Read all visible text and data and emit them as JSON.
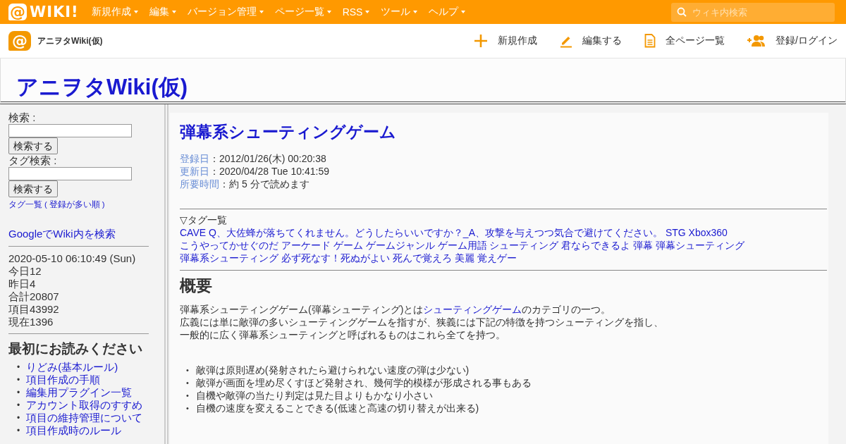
{
  "topbar": {
    "logo_symbol": "@",
    "logo_text": "WIKI!",
    "menus": [
      {
        "label": "新規作成"
      },
      {
        "label": "編集"
      },
      {
        "label": "バージョン管理"
      },
      {
        "label": "ページ一覧"
      },
      {
        "label": "RSS"
      },
      {
        "label": "ツール"
      },
      {
        "label": "ヘルプ"
      }
    ],
    "search": {
      "placeholder": "ウィキ内検索"
    }
  },
  "subbar": {
    "logo_symbol": "@",
    "site_name": "アニヲタWiki(仮)",
    "actions": [
      {
        "kind": "plus",
        "label": "新規作成"
      },
      {
        "kind": "pencil",
        "label": "編集する"
      },
      {
        "kind": "document",
        "label": "全ページ一覧"
      },
      {
        "kind": "user-add",
        "label": "登録/ログイン"
      }
    ]
  },
  "site_title": "アニヲタWiki(仮)",
  "sidebar": {
    "search_label": "検索 :",
    "search_button": "検索する",
    "tag_search_label": "タグ検索 :",
    "tag_search_button": "検索する",
    "tag_links": [
      {
        "label": "タグ一覧"
      },
      {
        "label": "登録が多い順"
      }
    ],
    "paren_open": "(",
    "paren_close": ")",
    "google_link": "GoogleでWiki内を検索",
    "counters": [
      "2020-05-10 06:10:49 (Sun)",
      "今日12",
      "昨日4",
      "合計20807",
      "項目43992",
      "現在1396"
    ],
    "read_first": {
      "heading": "最初にお読みください",
      "bullet": "•",
      "items": [
        "りどみ(基本ルール)",
        "項目作成の手順",
        "編集用プラグイン一覧",
        "アカウント取得のすすめ",
        "項目の維持管理について",
        "項目作成時のルール"
      ]
    }
  },
  "article": {
    "title": "弾幕系シューティングゲーム",
    "meta": [
      {
        "label": "登録日",
        "value": "：2012/01/26(木) 00:20:38"
      },
      {
        "label": "更新日",
        "value": "：2020/04/28 Tue 10:41:59"
      },
      {
        "label": "所要時間",
        "value": "：約 5 分で読めます"
      }
    ],
    "tags_heading": "▽タグ一覧",
    "tags": [
      "CAVE",
      "Q、大佐蜂が落ちてくれません。どうしたらいいですか？_A、攻撃を与えつつ気合で避けてください。",
      "STG",
      "Xbox360",
      "こうやってかせぐのだ",
      "アーケード",
      "ゲーム",
      "ゲームジャンル",
      "ゲーム用語",
      "シューティング",
      "君ならできるよ",
      "弾幕",
      "弾幕シューティング",
      "弾幕系シューティング",
      "必ず死なす！死ぬがよい",
      "死んで覚えろ",
      "美麗",
      "覚えゲー"
    ],
    "section_heading": "概要",
    "intro": [
      {
        "parts": [
          {
            "kind": "text",
            "text": "弾幕系シューティングゲーム(弾幕シューティング)とは"
          },
          {
            "kind": "link",
            "text": "シューティングゲーム"
          },
          {
            "kind": "text",
            "text": "のカテゴリの一つ。"
          }
        ]
      },
      {
        "parts": [
          {
            "kind": "text",
            "text": "広義には単に敵弾の多いシューティングゲームを指すが、狭義には下記の特徴を持つシューティングを指し、"
          }
        ]
      },
      {
        "parts": [
          {
            "kind": "text",
            "text": "一般的に広く弾幕系シューティングと呼ばれるものはこれら全てを持つ。"
          }
        ]
      }
    ],
    "bullet": "•",
    "features": [
      "敵弾は原則遅め(発射されたら避けられない速度の弾は少ない)",
      "敵弾が画面を埋め尽くすほど発射され、幾何学的模様が形成される事もある",
      "自機や敵弾の当たり判定は見た目よりもかなり小さい",
      "自機の速度を変えることできる(低速と高速の切り替えが出来る)"
    ]
  }
}
